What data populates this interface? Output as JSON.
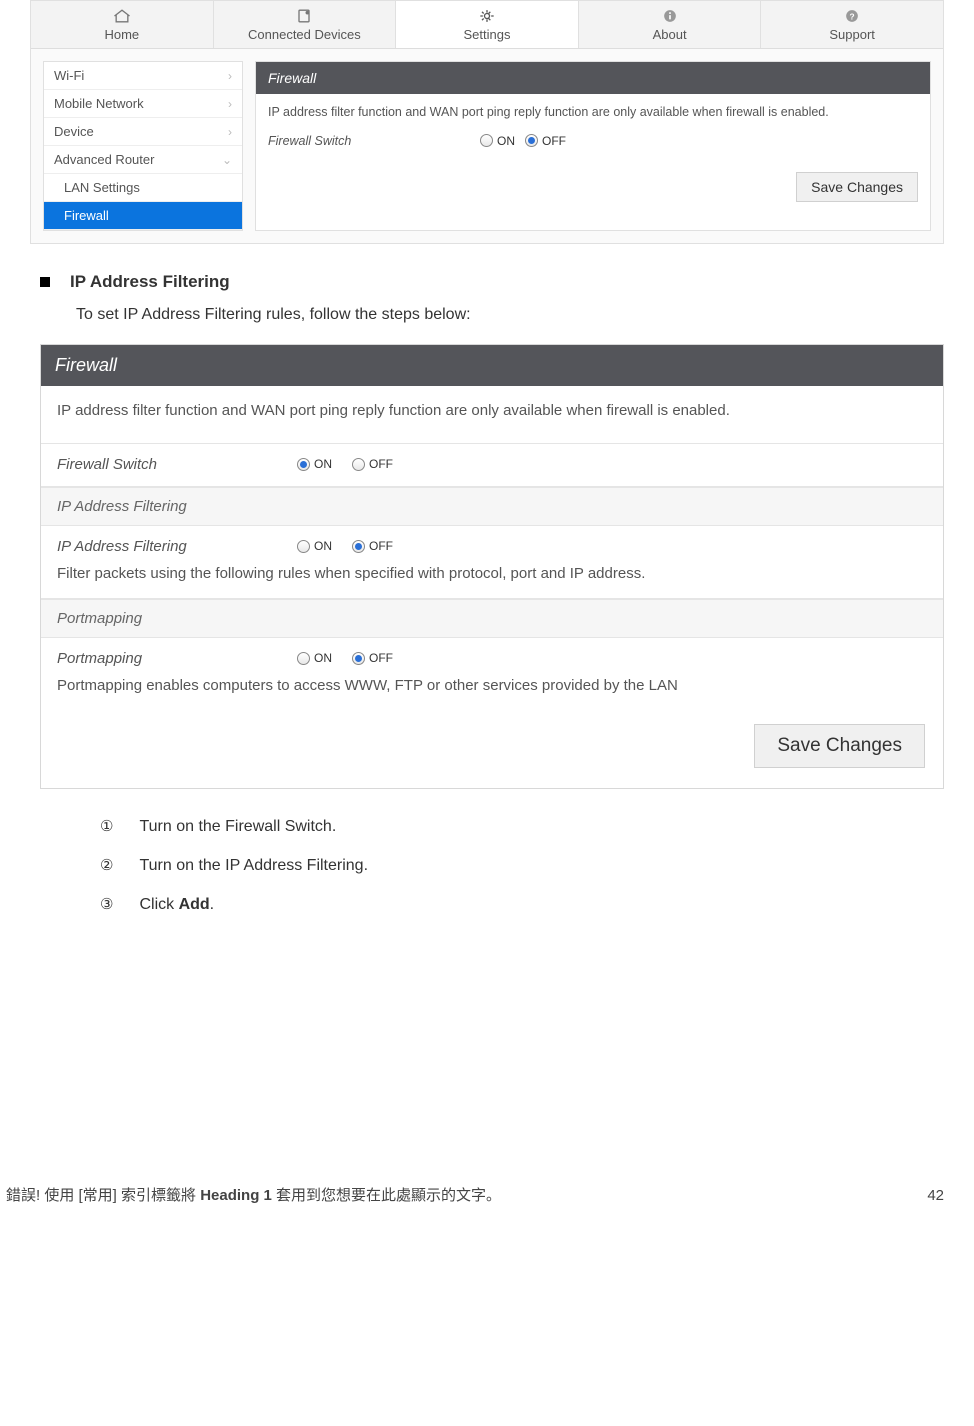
{
  "tabs": {
    "home": "Home",
    "connected": "Connected Devices",
    "settings": "Settings",
    "about": "About",
    "support": "Support"
  },
  "sidebar": {
    "wifi": "Wi-Fi",
    "mobile": "Mobile Network",
    "device": "Device",
    "adv": "Advanced Router",
    "lan": "LAN Settings",
    "firewall": "Firewall"
  },
  "panel1": {
    "title": "Firewall",
    "desc": "IP address filter function and WAN port ping reply function are only available when firewall is enabled.",
    "switch_label": "Firewall Switch",
    "on": "ON",
    "off": "OFF",
    "save": "Save Changes"
  },
  "doc": {
    "heading": "IP Address Filtering",
    "intro": "To set IP Address Filtering rules, follow the steps below:"
  },
  "panel2": {
    "title": "Firewall",
    "desc": "IP address filter function and WAN port ping reply function are only available when firewall is enabled.",
    "switch_label": "Firewall Switch",
    "on": "ON",
    "off": "OFF",
    "sec_ip": "IP Address Filtering",
    "ip_label": "IP Address Filtering",
    "ip_note": "Filter packets using the following rules when specified with protocol, port and IP address.",
    "sec_pm": "Portmapping",
    "pm_label": "Portmapping",
    "pm_note": "Portmapping enables computers to access WWW, FTP or other services provided by the LAN",
    "save": "Save Changes"
  },
  "steps": {
    "s1n": "①",
    "s1": "Turn on the Firewall Switch.",
    "s2n": "②",
    "s2": "Turn on the IP Address Filtering.",
    "s3n": "③",
    "s3_a": "Click ",
    "s3_b": "Add",
    "s3_c": "."
  },
  "footer": {
    "left_a": "錯誤! 使用 [常用] 索引標籤將 ",
    "left_b": "Heading 1",
    "left_c": " 套用到您想要在此處顯示的文字。",
    "page": "42"
  }
}
